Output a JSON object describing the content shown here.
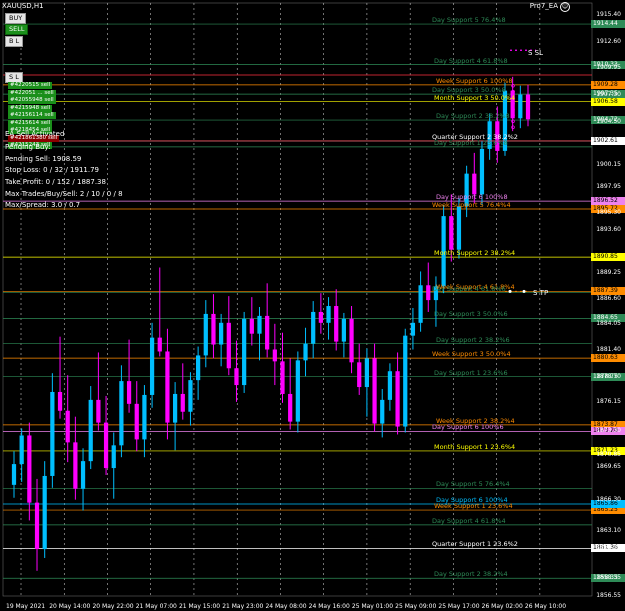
{
  "header": {
    "symbol": "XAUUSD,H1",
    "ea_name": "Pro7_EA",
    "ea_face": "☺"
  },
  "buttons": {
    "buy": "BUY",
    "sell": "SELL",
    "bl": "B L",
    "sl": "S L"
  },
  "tickets": [
    "#4220515 sell",
    "#422051 ... sell",
    "#42055948 sell",
    "#4215948 sell",
    "#42156114 sell",
    "#4215614 sell",
    "#4218454 sell",
    "#421861380 sell",
    "#4215243 sell"
  ],
  "info": {
    "status": "EA Sell Activated",
    "pending_buy": "Pending Buy:",
    "pending_sell": "Pending Sell: 1908.59",
    "stop_loss": "Stop Loss: 0 / 32 / 1911.79",
    "take_profit": "Take Profit: 0 / 152 / 1887.38",
    "max_trades": "Max Trades/Buy/Sell: 2 / 10 / 0 / 8",
    "max_spread": "Max/Spread: 3.0 / 0.7"
  },
  "markers": {
    "s_sl": "S SL",
    "s_tp": "S TP"
  },
  "colors": {
    "background": "#000000",
    "grid": "#ffffff",
    "bull": "#00bfff",
    "bear": "#ff00ff",
    "day": "#2e8b57",
    "week": "#ff8c00",
    "month": "#ffff00",
    "quarter": "#ffffff",
    "day6": "#ee82ee"
  },
  "chart_data": {
    "type": "candlestick",
    "symbol": "XAUUSD",
    "timeframe": "H1",
    "ylim": [
      1856.55,
      1916.57
    ],
    "y_ticks": [
      "1915.40",
      "1912.60",
      "1909.95",
      "1907.30",
      "1904.50",
      "1900.15",
      "1897.95",
      "1895.30",
      "1893.60",
      "1889.25",
      "1886.60",
      "1884.05",
      "1881.40",
      "1878.70",
      "1876.15",
      "1873.30",
      "1870.85",
      "1869.65",
      "1866.30",
      "1863.10",
      "1861.36",
      "1858.35",
      "1856.55"
    ],
    "x_ticks": [
      "19 May 2021",
      "20 May 14:00",
      "20 May 22:00",
      "21 May 07:00",
      "21 May 15:00",
      "21 May 23:00",
      "24 May 08:00",
      "24 May 16:00",
      "25 May 01:00",
      "25 May 09:00",
      "25 May 17:00",
      "26 May 02:00",
      "26 May 10:00"
    ],
    "levels": [
      {
        "label": "Day Support 5 76.4%8",
        "price": 1914.44,
        "color": "#2e8b57",
        "box": "1914.44"
      },
      {
        "label": "Day Support 4 61.8%8",
        "price": 1910.33,
        "color": "#2e8b57",
        "box": "1910.33"
      },
      {
        "label": "Week Support 6 100%8",
        "price": 1908.28,
        "color": "#ff8c00",
        "box": "1909.28"
      },
      {
        "label": "Day Support 3 50.0%8",
        "price": 1907.35,
        "color": "#2e8b57",
        "box": "1907.35"
      },
      {
        "label": "Month Support 3 50.0%4",
        "price": 1906.58,
        "color": "#ffff00",
        "box": "1906.58"
      },
      {
        "label": "Day Support 2 38.2%8",
        "price": 1904.72,
        "color": "#2e8b57",
        "box": "1904.72"
      },
      {
        "label": "Quarter Support 2 38.2%2",
        "price": 1902.61,
        "color": "#ffffff",
        "box": "1902.61"
      },
      {
        "label": "Day Support 1 23.6%8",
        "price": 1902.01,
        "color": "#2e8b57",
        "box": ""
      },
      {
        "label": "Day Support 6 100%8",
        "price": 1896.52,
        "color": "#ee82ee",
        "box": "1896.52"
      },
      {
        "label": "Week Support 5 76.4%4",
        "price": 1895.72,
        "color": "#ff8c00",
        "box": "1895.72"
      },
      {
        "label": "Month Support 2 38.2%4",
        "price": 1890.85,
        "color": "#ffff00",
        "box": "1890.85"
      },
      {
        "label": "Week Support 4 61.8%4",
        "price": 1887.39,
        "color": "#ff8c00",
        "box": "1887.39"
      },
      {
        "label": "Day Support 4 61.8%6",
        "price": 1887.25,
        "color": "#2e8b57",
        "box": ""
      },
      {
        "label": "Day Support 3 50.0%6",
        "price": 1884.65,
        "color": "#2e8b57",
        "box": "1884.65"
      },
      {
        "label": "Day Support 2 38.2%6",
        "price": 1882.09,
        "color": "#2e8b57",
        "box": ""
      },
      {
        "label": "Week Support 3 50.0%4",
        "price": 1880.63,
        "color": "#ff8c00",
        "box": "1880.63"
      },
      {
        "label": "Day Support 1 23.6%6",
        "price": 1878.75,
        "color": "#2e8b57",
        "box": "1878.75"
      },
      {
        "label": "Week Support 2 38.2%4",
        "price": 1873.87,
        "color": "#ff8c00",
        "box": "1873.87"
      },
      {
        "label": "Day Support 6 100%6",
        "price": 1873.2,
        "color": "#ee82ee",
        "box": "1873.20"
      },
      {
        "label": "Month Support 1 23.6%4",
        "price": 1871.23,
        "color": "#ffff00",
        "box": "1871.23"
      },
      {
        "label": "Day Support 5 76.4%4",
        "price": 1867.45,
        "color": "#2e8b57",
        "box": ""
      },
      {
        "label": "Day Support 4 61.8%4",
        "price": 1863.75,
        "color": "#2e8b57",
        "box": ""
      },
      {
        "label": "Week Support 1 23.6%4",
        "price": 1865.25,
        "color": "#ff8c00",
        "box": "1865.25"
      },
      {
        "label": "Day Support 6 100%4",
        "price": 1865.86,
        "color": "#00bfff",
        "box": "1865.86"
      },
      {
        "label": "Quarter Support 1 23.6%2",
        "price": 1861.36,
        "color": "#ffffff",
        "box": "1861.36"
      },
      {
        "label": "Day Support 2 38.2%4",
        "price": 1858.35,
        "color": "#2e8b57",
        "box": "1858.35"
      }
    ],
    "candles": [
      [
        1867.8,
        1871.2,
        1866.5,
        1869.9
      ],
      [
        1869.9,
        1873.5,
        1868.1,
        1872.8
      ],
      [
        1872.8,
        1874.1,
        1864.2,
        1866.0
      ],
      [
        1866.0,
        1868.4,
        1859.1,
        1861.3
      ],
      [
        1861.3,
        1870.2,
        1860.4,
        1868.7
      ],
      [
        1868.7,
        1879.1,
        1867.5,
        1877.2
      ],
      [
        1877.2,
        1882.8,
        1874.5,
        1875.3
      ],
      [
        1875.3,
        1878.9,
        1870.1,
        1872.1
      ],
      [
        1872.1,
        1874.7,
        1866.3,
        1867.4
      ],
      [
        1867.4,
        1871.5,
        1865.2,
        1870.2
      ],
      [
        1870.2,
        1877.8,
        1869.4,
        1876.4
      ],
      [
        1876.4,
        1881.2,
        1873.3,
        1874.1
      ],
      [
        1874.1,
        1876.8,
        1868.8,
        1869.5
      ],
      [
        1869.5,
        1873.1,
        1866.4,
        1871.8
      ],
      [
        1871.8,
        1879.9,
        1870.6,
        1878.3
      ],
      [
        1878.3,
        1882.5,
        1875.1,
        1876.0
      ],
      [
        1876.0,
        1878.3,
        1871.2,
        1872.4
      ],
      [
        1872.4,
        1877.9,
        1870.6,
        1876.9
      ],
      [
        1876.9,
        1884.2,
        1875.6,
        1882.7
      ],
      [
        1882.7,
        1889.8,
        1880.8,
        1881.3
      ],
      [
        1881.3,
        1883.6,
        1872.4,
        1874.1
      ],
      [
        1874.1,
        1878.2,
        1871.3,
        1877.0
      ],
      [
        1877.0,
        1880.1,
        1874.4,
        1875.2
      ],
      [
        1875.2,
        1879.2,
        1873.8,
        1878.4
      ],
      [
        1878.4,
        1881.8,
        1876.4,
        1880.9
      ],
      [
        1880.9,
        1886.5,
        1879.7,
        1885.1
      ],
      [
        1885.1,
        1887.1,
        1880.6,
        1882.0
      ],
      [
        1882.0,
        1885.1,
        1879.8,
        1884.2
      ],
      [
        1884.2,
        1886.9,
        1878.9,
        1879.6
      ],
      [
        1879.6,
        1882.4,
        1876.2,
        1877.9
      ],
      [
        1877.9,
        1885.3,
        1877.1,
        1884.6
      ],
      [
        1884.6,
        1886.8,
        1881.9,
        1883.1
      ],
      [
        1883.1,
        1885.8,
        1880.4,
        1884.9
      ],
      [
        1884.9,
        1888.2,
        1880.7,
        1881.5
      ],
      [
        1881.5,
        1884.1,
        1877.9,
        1880.3
      ],
      [
        1880.3,
        1883.2,
        1876.1,
        1877.0
      ],
      [
        1877.0,
        1880.6,
        1873.4,
        1874.2
      ],
      [
        1874.2,
        1881.3,
        1873.1,
        1880.4
      ],
      [
        1880.4,
        1883.7,
        1878.8,
        1882.1
      ],
      [
        1882.1,
        1886.4,
        1880.6,
        1885.3
      ],
      [
        1885.3,
        1887.2,
        1883.1,
        1884.2
      ],
      [
        1884.2,
        1886.8,
        1882.5,
        1885.9
      ],
      [
        1885.9,
        1887.6,
        1881.4,
        1882.3
      ],
      [
        1882.3,
        1885.2,
        1880.7,
        1884.6
      ],
      [
        1884.6,
        1885.9,
        1879.1,
        1880.2
      ],
      [
        1880.2,
        1882.1,
        1876.9,
        1877.7
      ],
      [
        1877.7,
        1881.6,
        1874.7,
        1880.6
      ],
      [
        1880.6,
        1882.1,
        1873.2,
        1874.0
      ],
      [
        1874.0,
        1877.5,
        1872.6,
        1876.4
      ],
      [
        1876.4,
        1880.1,
        1875.3,
        1879.3
      ],
      [
        1879.3,
        1881.2,
        1872.9,
        1873.7
      ],
      [
        1873.7,
        1883.6,
        1873.1,
        1882.9
      ],
      [
        1882.9,
        1885.7,
        1881.5,
        1884.2
      ],
      [
        1884.2,
        1889.4,
        1883.3,
        1888.0
      ],
      [
        1888.0,
        1890.3,
        1885.3,
        1886.5
      ],
      [
        1886.5,
        1888.9,
        1883.8,
        1887.9
      ],
      [
        1887.9,
        1896.1,
        1887.2,
        1895.0
      ],
      [
        1895.0,
        1897.2,
        1890.4,
        1891.6
      ],
      [
        1891.6,
        1896.8,
        1890.7,
        1896.0
      ],
      [
        1896.0,
        1900.1,
        1894.9,
        1899.3
      ],
      [
        1899.3,
        1901.4,
        1896.3,
        1897.2
      ],
      [
        1897.2,
        1902.6,
        1896.1,
        1901.8
      ],
      [
        1901.8,
        1905.4,
        1900.7,
        1904.6
      ],
      [
        1904.6,
        1906.1,
        1900.4,
        1901.6
      ],
      [
        1901.6,
        1908.5,
        1901.1,
        1907.7
      ],
      [
        1907.7,
        1909.1,
        1903.6,
        1904.9
      ],
      [
        1904.9,
        1908.2,
        1903.9,
        1907.3
      ],
      [
        1907.3,
        1908.3,
        1904.1,
        1904.8
      ]
    ]
  }
}
